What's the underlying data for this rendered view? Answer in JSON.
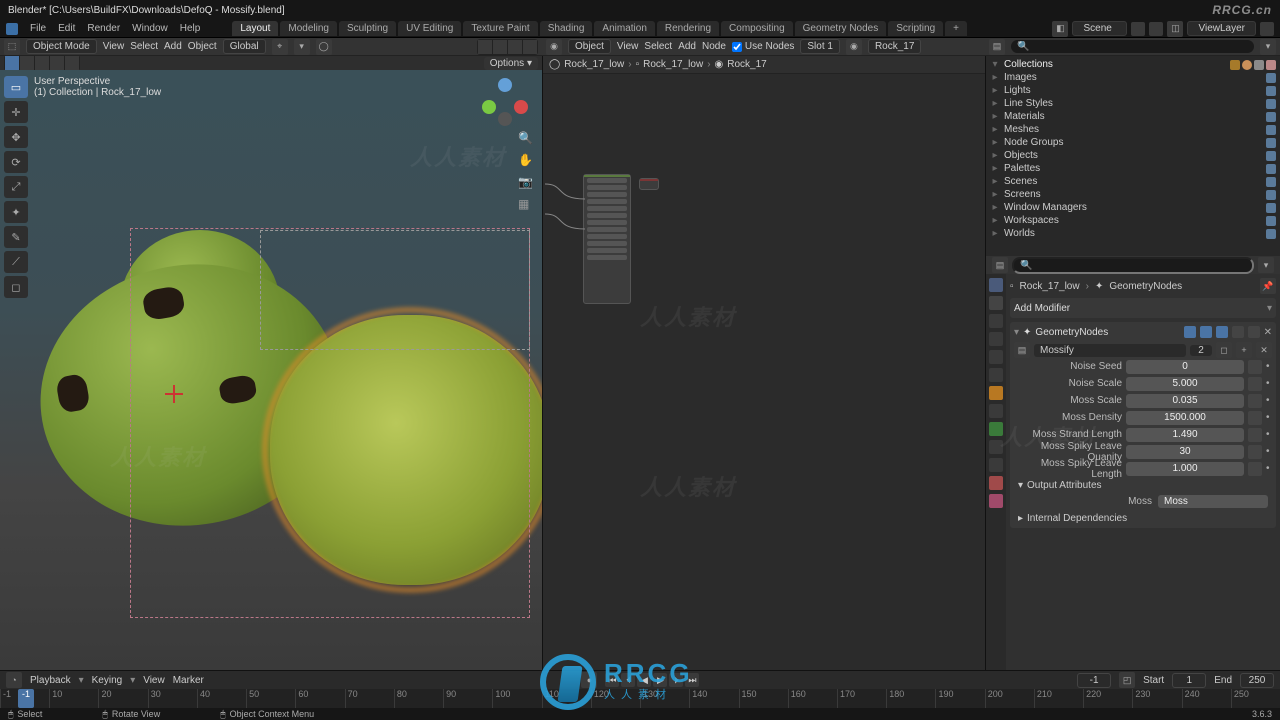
{
  "title_bar": {
    "text": "Blender* [C:\\Users\\BuildFX\\Downloads\\DefoQ - Mossify.blend]",
    "watermark": "RRCG.cn"
  },
  "menu": {
    "items": [
      "File",
      "Edit",
      "Render",
      "Window",
      "Help"
    ],
    "workspaces": [
      "Layout",
      "Modeling",
      "Sculpting",
      "UV Editing",
      "Texture Paint",
      "Shading",
      "Animation",
      "Rendering",
      "Compositing",
      "Geometry Nodes",
      "Scripting"
    ],
    "active_workspace": "Layout",
    "scene": "Scene",
    "viewlayer": "ViewLayer"
  },
  "viewport_header": {
    "mode": "Object Mode",
    "menus": [
      "View",
      "Select",
      "Add",
      "Object"
    ],
    "orientation": "Global",
    "options_label": "Options"
  },
  "overlay": {
    "line1": "User Perspective",
    "line2": "(1) Collection | Rock_17_low"
  },
  "node_header": {
    "menus": [
      "View",
      "Select",
      "Add",
      "Node"
    ],
    "mode": "Object",
    "use_nodes": "Use Nodes",
    "slot": "Slot 1",
    "material": "Rock_17"
  },
  "node_crumbs": [
    "Rock_17_low",
    "Rock_17_low",
    "Rock_17"
  ],
  "outliner": {
    "search_placeholder": "",
    "root": "Collections",
    "items": [
      "Images",
      "Lights",
      "Line Styles",
      "Materials",
      "Meshes",
      "Node Groups",
      "Objects",
      "Palettes",
      "Scenes",
      "Screens",
      "Window Managers",
      "Workspaces",
      "Worlds"
    ]
  },
  "properties": {
    "crumb_obj": "Rock_17_low",
    "crumb_mod": "GeometryNodes",
    "add_modifier": "Add Modifier",
    "modifier_name": "GeometryNodes",
    "nodegroup": "Mossify",
    "nodegroup_users": "2",
    "params": [
      {
        "label": "Noise Seed",
        "value": "0"
      },
      {
        "label": "Noise Scale",
        "value": "5.000"
      },
      {
        "label": "Moss Scale",
        "value": "0.035"
      },
      {
        "label": "Moss Density",
        "value": "1500.000"
      },
      {
        "label": "Moss Strand Length",
        "value": "1.490"
      },
      {
        "label": "Moss Spiky Leave Quanity",
        "value": "30"
      },
      {
        "label": "Moss Spiky Leave Length",
        "value": "1.000"
      }
    ],
    "output_attr_section": "Output Attributes",
    "output_attr": {
      "label": "Moss",
      "value": "Moss"
    },
    "internal_deps": "Internal Dependencies"
  },
  "timeline": {
    "menus": [
      "Playback",
      "Keying",
      "View",
      "Marker"
    ],
    "current": "-1",
    "start_label": "Start",
    "start": "1",
    "end_label": "End",
    "end": "250",
    "ticks": [
      "-1",
      "10",
      "20",
      "30",
      "40",
      "50",
      "60",
      "70",
      "80",
      "90",
      "100",
      "110",
      "120",
      "130",
      "140",
      "150",
      "160",
      "170",
      "180",
      "190",
      "200",
      "210",
      "220",
      "230",
      "240",
      "250"
    ]
  },
  "status": {
    "select": "Select",
    "rotate": "Rotate View",
    "context": "Object Context Menu",
    "version": "3.6.3"
  },
  "bigmark": {
    "title": "RRCG",
    "sub": "人人素材"
  }
}
